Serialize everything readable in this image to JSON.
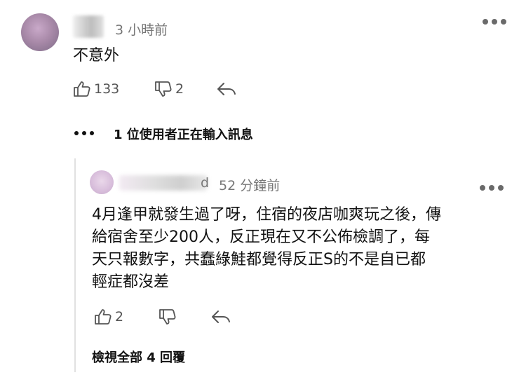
{
  "comment1": {
    "timestamp": "3 小時前",
    "text": "不意外",
    "likes": "133",
    "dislikes": "2"
  },
  "typing_indicator": "1 位使用者正在輸入訊息",
  "reply1": {
    "name_tail": "d",
    "timestamp": "52 分鐘前",
    "lines": [
      "4月逢甲就發生過了呀，住宿的夜店咖爽玩之後，傳",
      "給宿舍至少200人，反正現在又不公佈檢調了，每",
      "天只報數字，共蠢綠鮭都覺得反正S的不是自已都",
      "輕症都沒差"
    ],
    "likes": "2"
  },
  "view_all_replies": "檢視全部 4 回覆",
  "icons": {
    "like": "thumbs-up-icon",
    "dislike": "thumbs-down-icon",
    "reply": "reply-arrow-icon",
    "more": "more-dots-icon"
  }
}
